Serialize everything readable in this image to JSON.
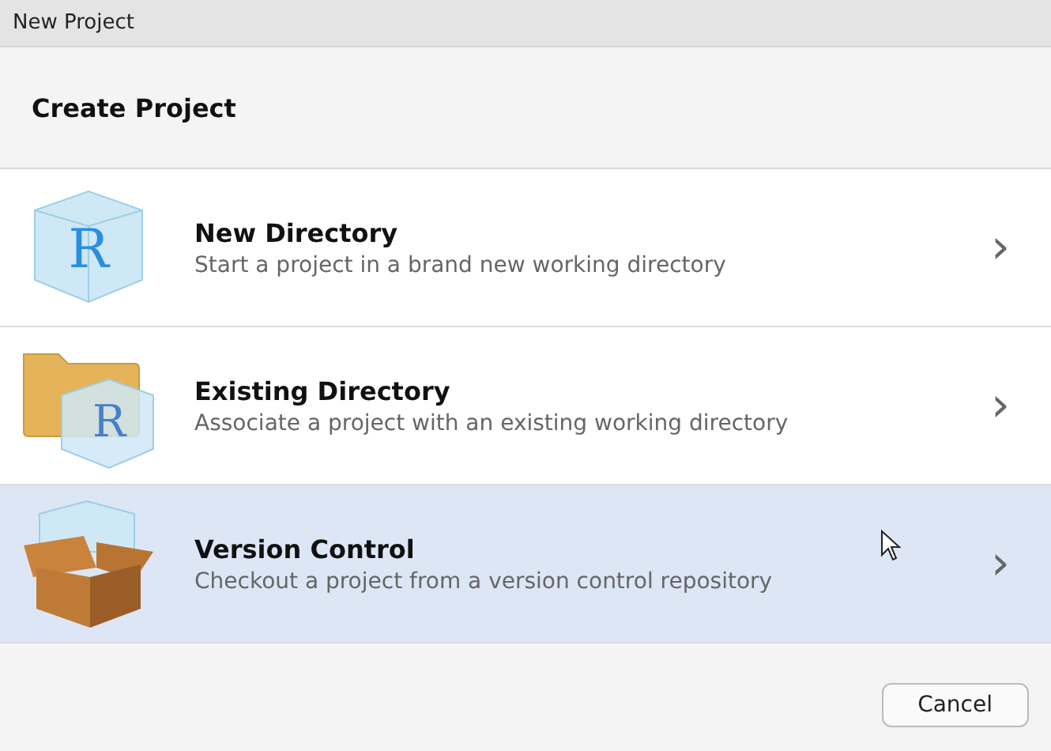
{
  "window": {
    "title": "New Project"
  },
  "header": {
    "title": "Create Project"
  },
  "options": [
    {
      "kind": "cube",
      "icon_letter": "R",
      "title": "New Directory",
      "description": "Start a project in a brand new working directory",
      "selected": false
    },
    {
      "kind": "folder",
      "icon_letter": "R",
      "title": "Existing Directory",
      "description": "Associate a project with an existing working directory",
      "selected": false
    },
    {
      "kind": "box",
      "title": "Version Control",
      "description": "Checkout a project from a version control repository",
      "selected": true
    }
  ],
  "chevron": "›",
  "buttons": [
    {
      "label": "Cancel"
    }
  ]
}
